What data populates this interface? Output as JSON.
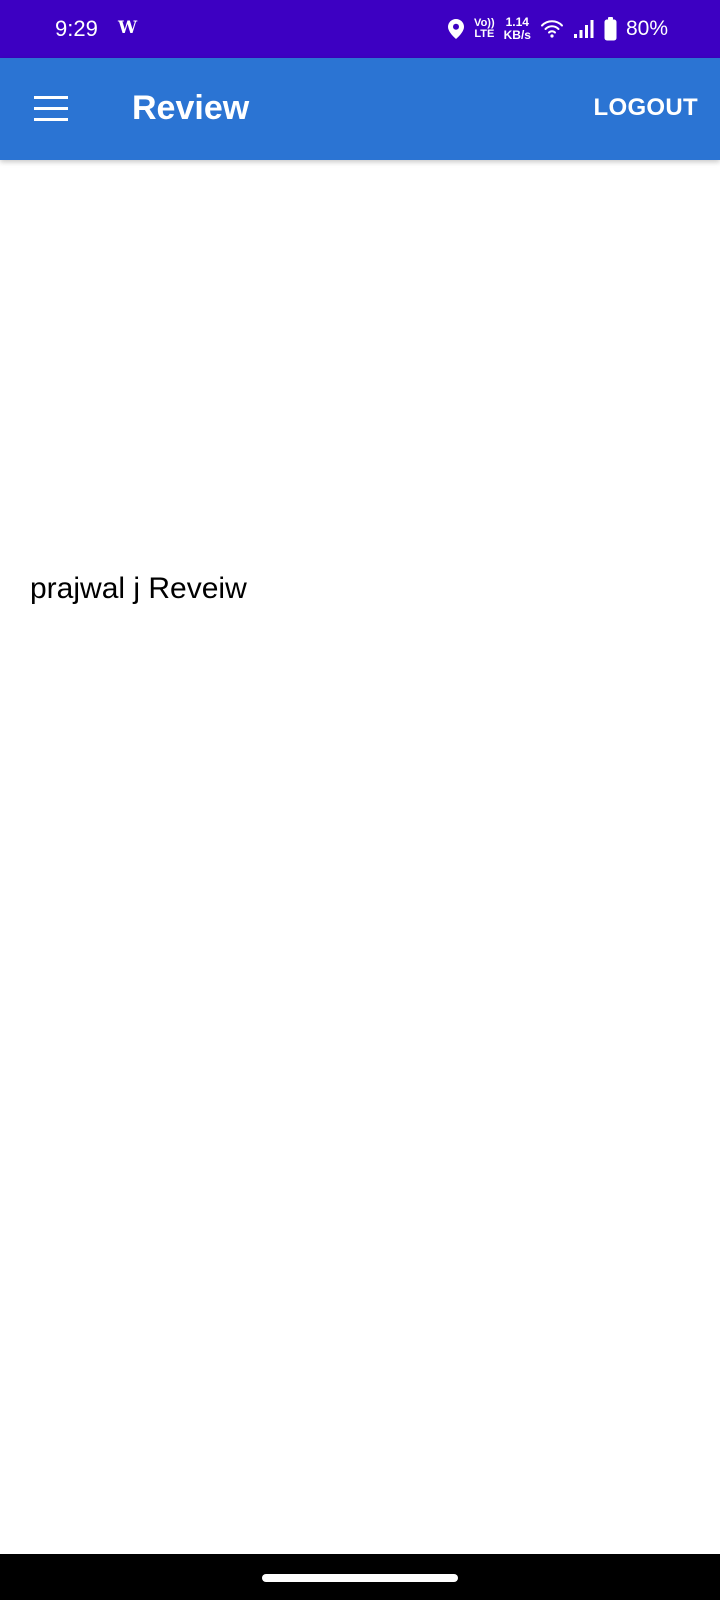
{
  "status_bar": {
    "time": "9:29",
    "app_indicator": "W",
    "network_label_top": "Vo))",
    "network_label_bottom": "LTE",
    "speed_value": "1.14",
    "speed_unit": "KB/s",
    "battery": "80%",
    "icons": [
      "location-icon",
      "wifi-icon",
      "signal-icon",
      "battery-icon"
    ],
    "background": "#3d00c2"
  },
  "app_bar": {
    "title": "Review",
    "logout_label": "LOGOUT",
    "menu_icon": "menu-icon",
    "background": "#2b74d3"
  },
  "main": {
    "review_text": "prajwal j Reveiw"
  }
}
